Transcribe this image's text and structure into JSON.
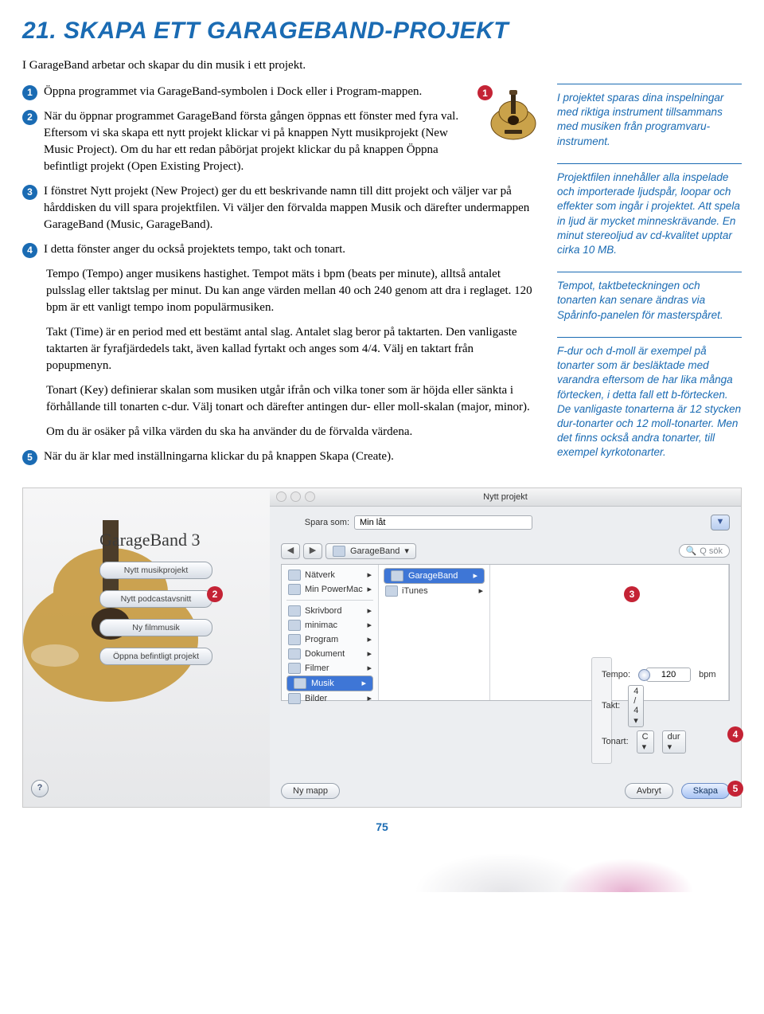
{
  "title": "21. SKAPA ETT GARAGEBAND-PROJEKT",
  "intro": "I GarageBand arbetar och skapar du din musik i ett projekt.",
  "guitar_callout": "1",
  "steps": [
    {
      "n": "1",
      "text": "Öppna programmet via GarageBand-symbolen i Dock eller i Program-mappen."
    },
    {
      "n": "2",
      "text": "När du öppnar programmet GarageBand första gången öppnas ett fönster med fyra val. Eftersom vi ska skapa ett nytt projekt klickar vi på knappen Nytt musikprojekt (New Music Project). Om du har ett redan påbörjat projekt klickar du på knappen Öppna befintligt projekt (Open Existing Project)."
    },
    {
      "n": "3",
      "text": "I fönstret Nytt projekt (New Project) ger du ett beskrivande namn till ditt projekt och väljer var på hårddisken du vill spara projektfilen. Vi väljer den förvalda mappen Musik och därefter undermappen GarageBand (Music, GarageBand)."
    },
    {
      "n": "4",
      "text": "I detta fönster anger du också projektets tempo, takt och tonart."
    }
  ],
  "paras": [
    "Tempo (Tempo) anger musikens hastighet. Tempot mäts i bpm (beats per minute), alltså antalet pulsslag eller taktslag per minut. Du kan ange värden mellan 40 och 240 genom att dra i reglaget. 120 bpm är ett vanligt tempo inom populärmusiken.",
    "Takt (Time) är en period med ett bestämt antal slag. Antalet slag beror på taktarten. Den vanligaste taktarten är fyrafjärdedels takt, även kallad fyrtakt och anges som 4/4. Välj en taktart från popupmenyn.",
    "Tonart (Key) definierar skalan som musiken utgår ifrån och vilka toner som är höjda eller sänkta i förhållande till tonarten c-dur. Välj tonart och därefter antingen dur- eller moll-skalan (major, minor).",
    "Om du är osäker på vilka värden du ska ha använder du de förvalda värdena."
  ],
  "step5": {
    "n": "5",
    "text": "När du är klar med inställningarna klickar du på knappen Skapa (Create)."
  },
  "sidebar": [
    "I projektet sparas dina inspelningar med riktiga instrument tillsammans med musiken från programvaru­instrument.",
    "Projektfilen innehåller alla inspelade och importerade ljudspår, loopar och effekter som ingår i projektet. Att spela in ljud är mycket minneskrävande. En minut stereoljud av cd-kvalitet upptar cirka 10 MB.",
    "Tempot, taktbeteckningen och tonarten kan senare ändras via Spårinfo-panelen för masterspåret.",
    "F-dur och d-moll är exempel på tonarter som är besläktade med varandra eftersom de har lika många förtecken, i detta fall ett b-förtecken. De vanligaste tonarterna är 12 stycken dur-tonarter och 12 moll-tonarter. Men det finns också andra tonarter, till exempel kyrkotonarter."
  ],
  "shot": {
    "gb_title": "GarageBand 3",
    "gb_buttons": [
      "Nytt musikprojekt",
      "Nytt podcastavsnitt",
      "Ny filmmusik",
      "Öppna befintligt projekt"
    ],
    "help": "?",
    "dialog_title": "Nytt projekt",
    "save_label": "Spara som:",
    "save_value": "Min låt",
    "nav": {
      "back": "◀",
      "fwd": "▶",
      "loc": "GarageBand",
      "search_label": "Q sök"
    },
    "col1": [
      "Nätverk",
      "Min PowerMac",
      "Skrivbord",
      "minimac",
      "Program",
      "Dokument",
      "Filmer",
      "Musik",
      "Bilder"
    ],
    "col1_sel": "Musik",
    "col2": [
      "GarageBand",
      "iTunes"
    ],
    "col2_sel": "GarageBand",
    "settings": {
      "tempo_label": "Tempo:",
      "tempo_value": "120",
      "tempo_unit": "bpm",
      "takt_label": "Takt:",
      "takt_value": "4 / 4",
      "tonart_label": "Tonart:",
      "tonart_key": "C",
      "tonart_scale": "dur"
    },
    "btn_newfolder": "Ny mapp",
    "btn_cancel": "Avbryt",
    "btn_create": "Skapa"
  },
  "callouts": {
    "c2": "2",
    "c3": "3",
    "c4": "4",
    "c5": "5"
  },
  "pagenum": "75"
}
